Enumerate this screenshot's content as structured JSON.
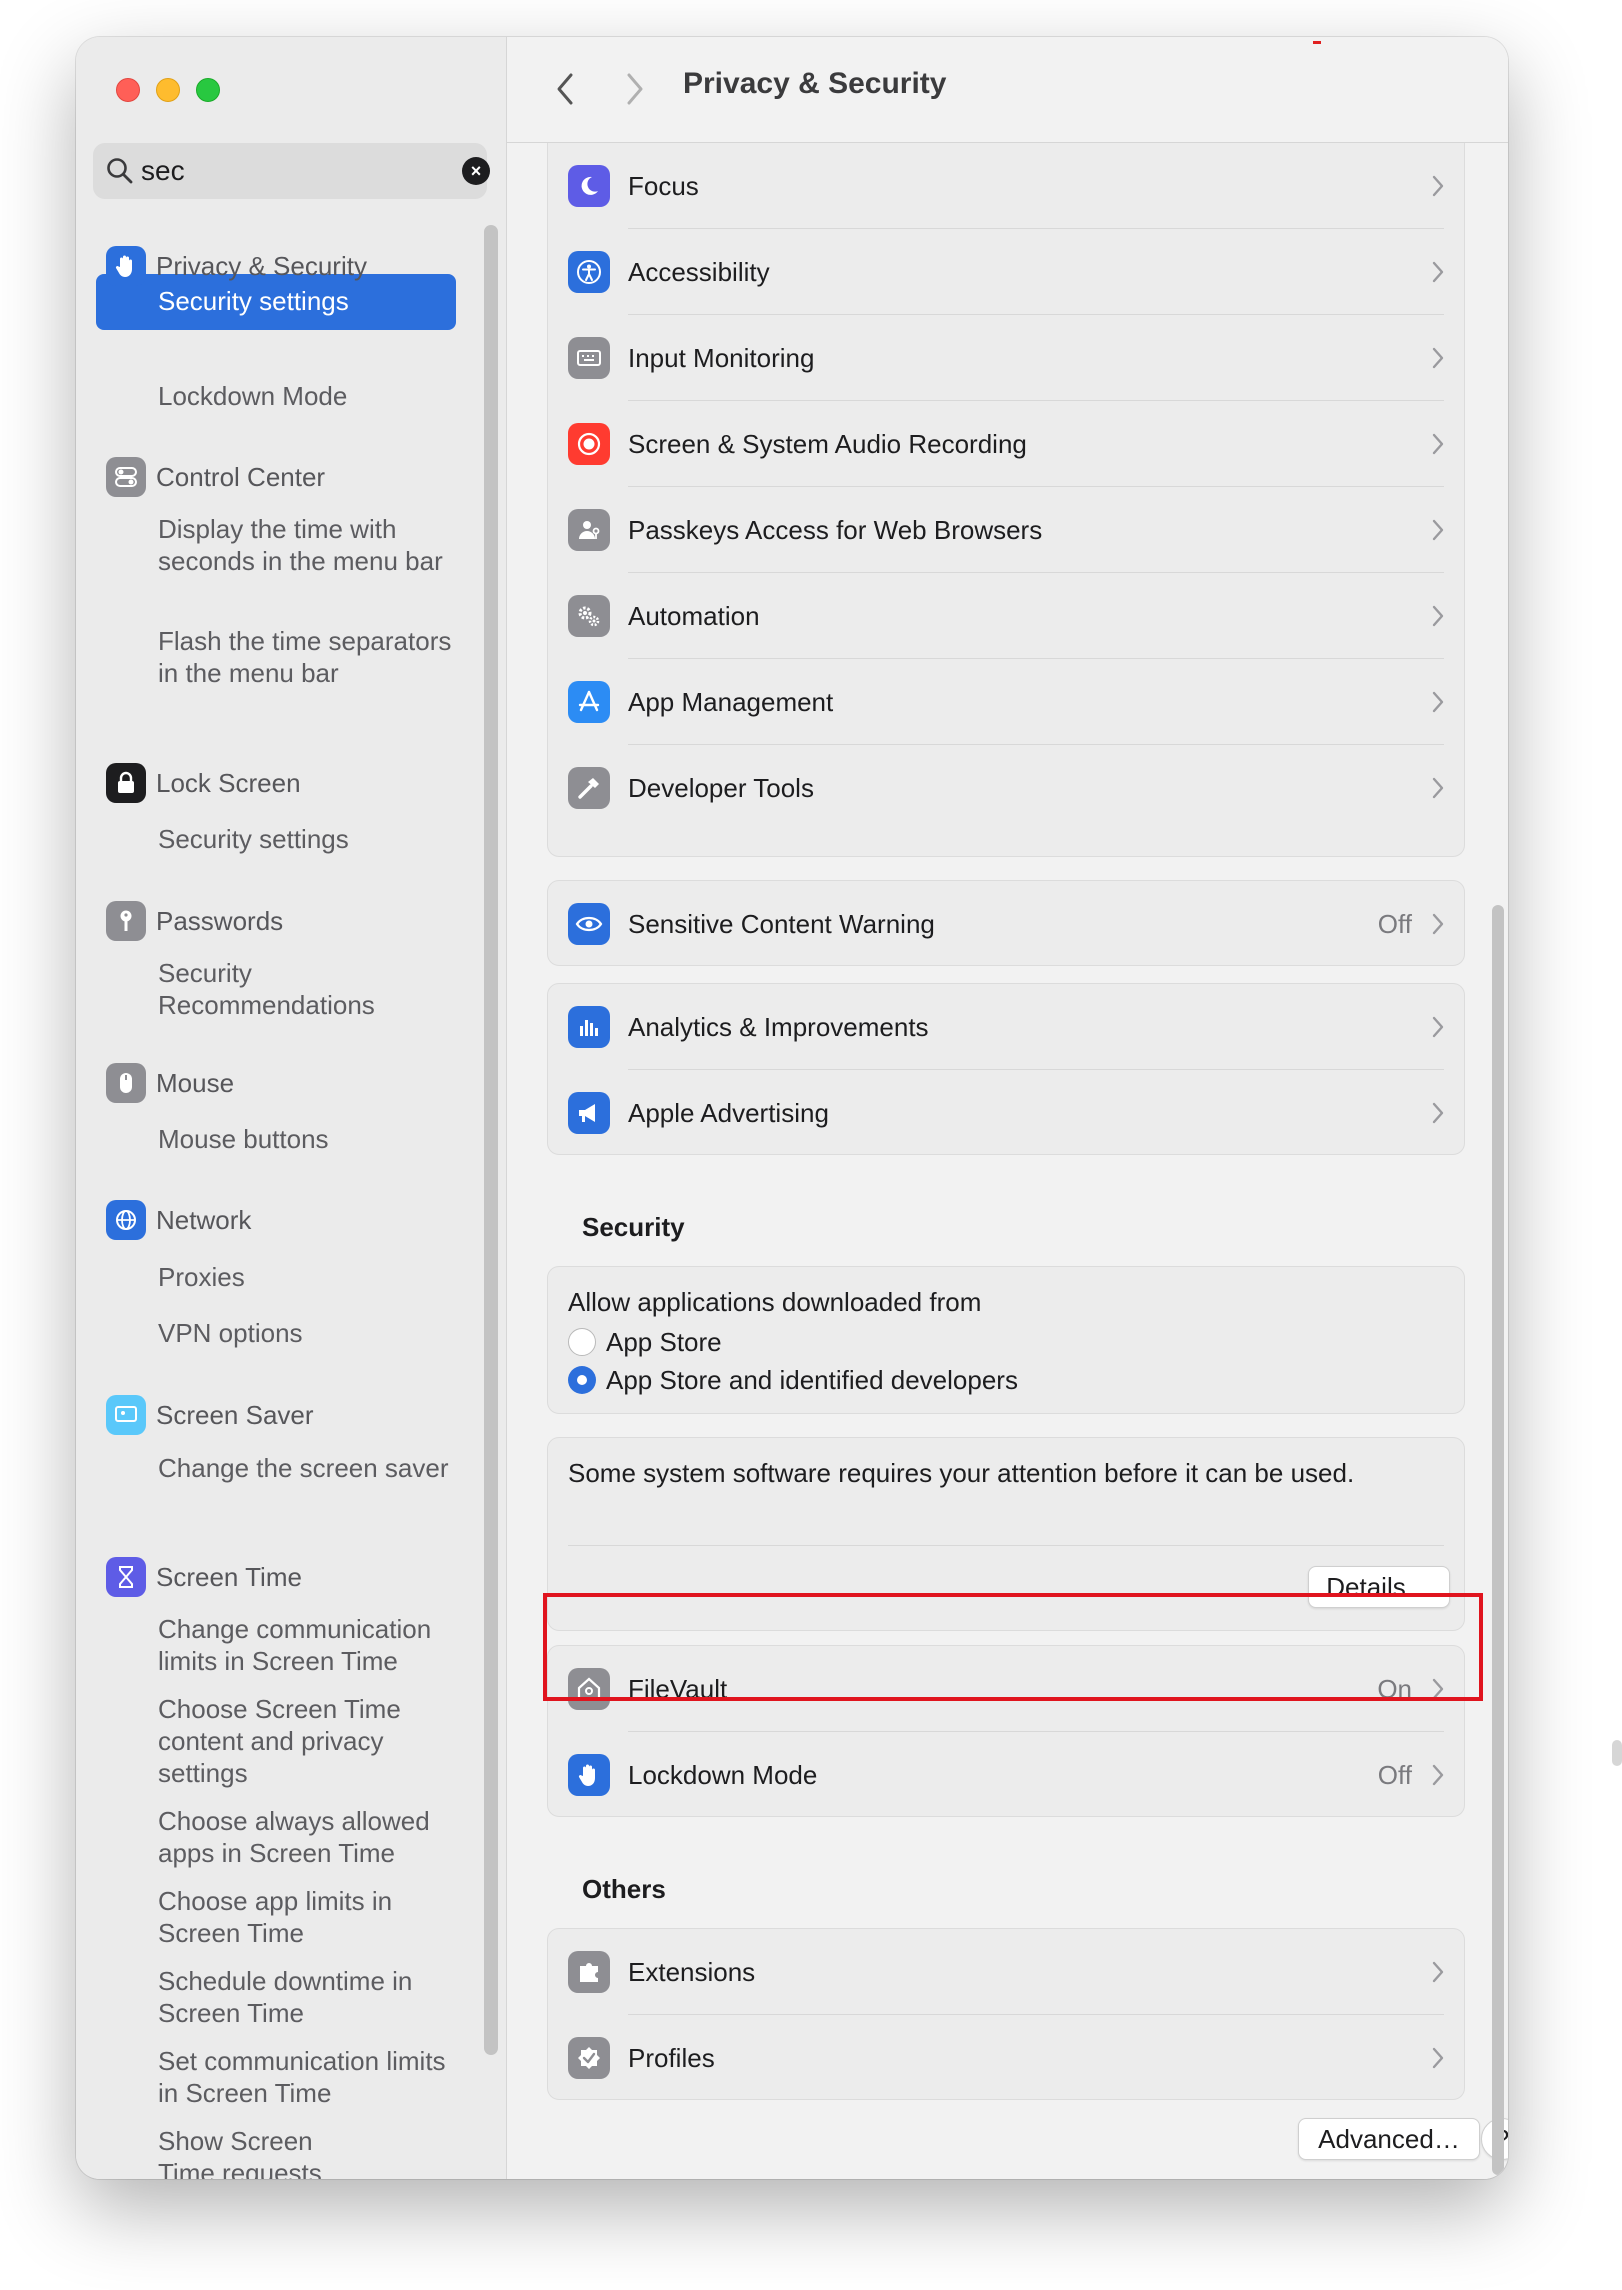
{
  "search": {
    "value": "sec"
  },
  "sidebar": {
    "groups": [
      {
        "label": "Privacy & Security",
        "icon": "hand-icon",
        "color": "#2c6fdc",
        "items": [
          "Security settings",
          "Lockdown Mode"
        ]
      },
      {
        "label": "Control Center",
        "icon": "toggles-icon",
        "color": "#8e8e93",
        "items": [
          "Display the time with seconds in the menu bar",
          "Flash the time separators in the menu bar"
        ]
      },
      {
        "label": "Lock Screen",
        "icon": "lock-icon",
        "color": "#1d1d1f",
        "items": [
          "Security settings"
        ]
      },
      {
        "label": "Passwords",
        "icon": "key-icon",
        "color": "#8e8e93",
        "items": [
          "Security Recommendations"
        ]
      },
      {
        "label": "Mouse",
        "icon": "mouse-icon",
        "color": "#8e8e93",
        "items": [
          "Mouse buttons"
        ]
      },
      {
        "label": "Network",
        "icon": "globe-icon",
        "color": "#2c6fdc",
        "items": [
          "Proxies",
          "VPN options"
        ]
      },
      {
        "label": "Screen Saver",
        "icon": "screen-saver-icon",
        "color": "#5ac8fa",
        "items": [
          "Change the screen saver"
        ]
      },
      {
        "label": "Screen Time",
        "icon": "hourglass-icon",
        "color": "#5e5ce6",
        "items": [
          "Change communication limits in Screen Time",
          "Choose Screen Time content and privacy settings",
          "Choose always allowed apps in Screen Time",
          "Choose app limits in Screen Time",
          "Schedule downtime in Screen Time",
          "Set communication limits in Screen Time",
          "Show Screen Time requests"
        ]
      }
    ]
  },
  "header": {
    "title": "Privacy & Security"
  },
  "main": {
    "permissions": [
      {
        "label": "Focus",
        "icon": "moon-icon",
        "color": "#5e5ce6"
      },
      {
        "label": "Accessibility",
        "icon": "accessibility-icon",
        "color": "#2c6fdc"
      },
      {
        "label": "Input Monitoring",
        "icon": "keyboard-icon",
        "color": "#8e8e93"
      },
      {
        "label": "Screen & System Audio Recording",
        "icon": "record-icon",
        "color": "#ff3b30"
      },
      {
        "label": "Passkeys Access for Web Browsers",
        "icon": "person-key-icon",
        "color": "#8e8e93"
      },
      {
        "label": "Automation",
        "icon": "gears-icon",
        "color": "#8e8e93"
      },
      {
        "label": "App Management",
        "icon": "app-store-icon",
        "color": "#2c8cf4"
      },
      {
        "label": "Developer Tools",
        "icon": "hammer-icon",
        "color": "#8e8e93"
      }
    ],
    "sensitive": {
      "label": "Sensitive Content Warning",
      "value": "Off",
      "icon": "eye-warning-icon",
      "color": "#2c6fdc"
    },
    "analytics": [
      {
        "label": "Analytics & Improvements",
        "icon": "bar-chart-icon",
        "color": "#2c6fdc"
      },
      {
        "label": "Apple Advertising",
        "icon": "megaphone-icon",
        "color": "#2c6fdc"
      }
    ],
    "security": {
      "title": "Security",
      "allow_label": "Allow applications downloaded from",
      "options": [
        "App Store",
        "App Store and identified developers"
      ],
      "selected_index": 1,
      "attention_text": "Some system software requires your attention before it can be used.",
      "details_button": "Details…",
      "filevault": {
        "label": "FileVault",
        "value": "On",
        "icon": "house-lock-icon",
        "color": "#8e8e93"
      },
      "lockdown": {
        "label": "Lockdown Mode",
        "value": "Off",
        "icon": "hand-icon",
        "color": "#2c6fdc"
      }
    },
    "others": {
      "title": "Others",
      "items": [
        {
          "label": "Extensions",
          "icon": "puzzle-icon",
          "color": "#8e8e93"
        },
        {
          "label": "Profiles",
          "icon": "checkmark-badge-icon",
          "color": "#8e8e93"
        }
      ]
    },
    "advanced_button": "Advanced…",
    "help_button": "?"
  }
}
